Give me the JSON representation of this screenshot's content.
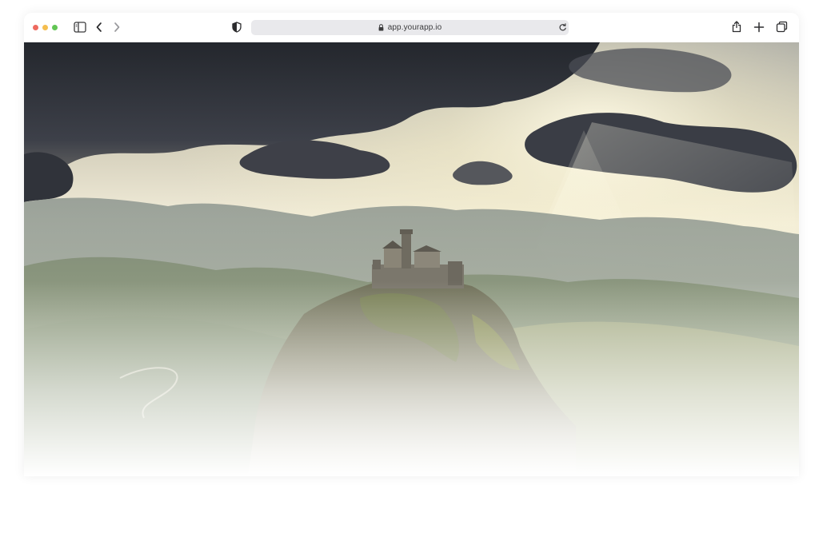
{
  "browser": {
    "url": "app.yourapp.io",
    "traffic_lights": {
      "close": "#ee6a5f",
      "minimize": "#f5be4f",
      "zoom": "#62c554"
    },
    "icons": {
      "sidebar": "sidebar-toggle-icon",
      "back": "chevron-left-icon",
      "forward": "chevron-right-icon",
      "privacy": "shield-icon",
      "lock": "lock-icon",
      "reload": "reload-icon",
      "share": "share-icon",
      "new_tab": "plus-icon",
      "tabs": "tab-overview-icon"
    }
  },
  "hero_image": {
    "subject": "castle-on-mountain-landscape",
    "colors": {
      "sky_dark": "#2a2e36",
      "sky_light": "#f3eedb",
      "hills": "#9aa58c",
      "castle": "#7b776c"
    }
  }
}
